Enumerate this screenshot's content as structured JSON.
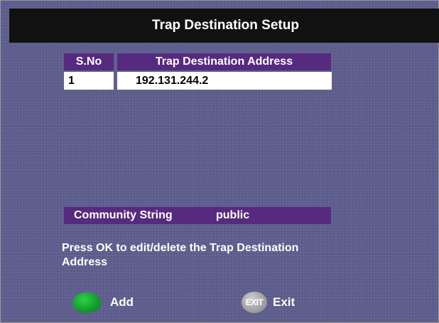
{
  "title": "Trap Destination Setup",
  "table": {
    "headers": {
      "sno": "S.No",
      "address": "Trap Destination Address"
    },
    "rows": [
      {
        "sno": "1",
        "address": "192.131.244.2"
      }
    ]
  },
  "community": {
    "label": "Community String",
    "value": "public"
  },
  "instruction": "Press OK to edit/delete the Trap Destination Address",
  "buttons": {
    "add": {
      "key_icon": "green-key-icon",
      "label": "Add",
      "color": "#0f9a2a"
    },
    "exit": {
      "key_icon": "exit-key-icon",
      "key_text": "EXIT",
      "label": "Exit"
    }
  },
  "colors": {
    "background": "#5e5e8e",
    "titlebar": "#111111",
    "header": "#562a7e",
    "cell": "#ffffff"
  }
}
